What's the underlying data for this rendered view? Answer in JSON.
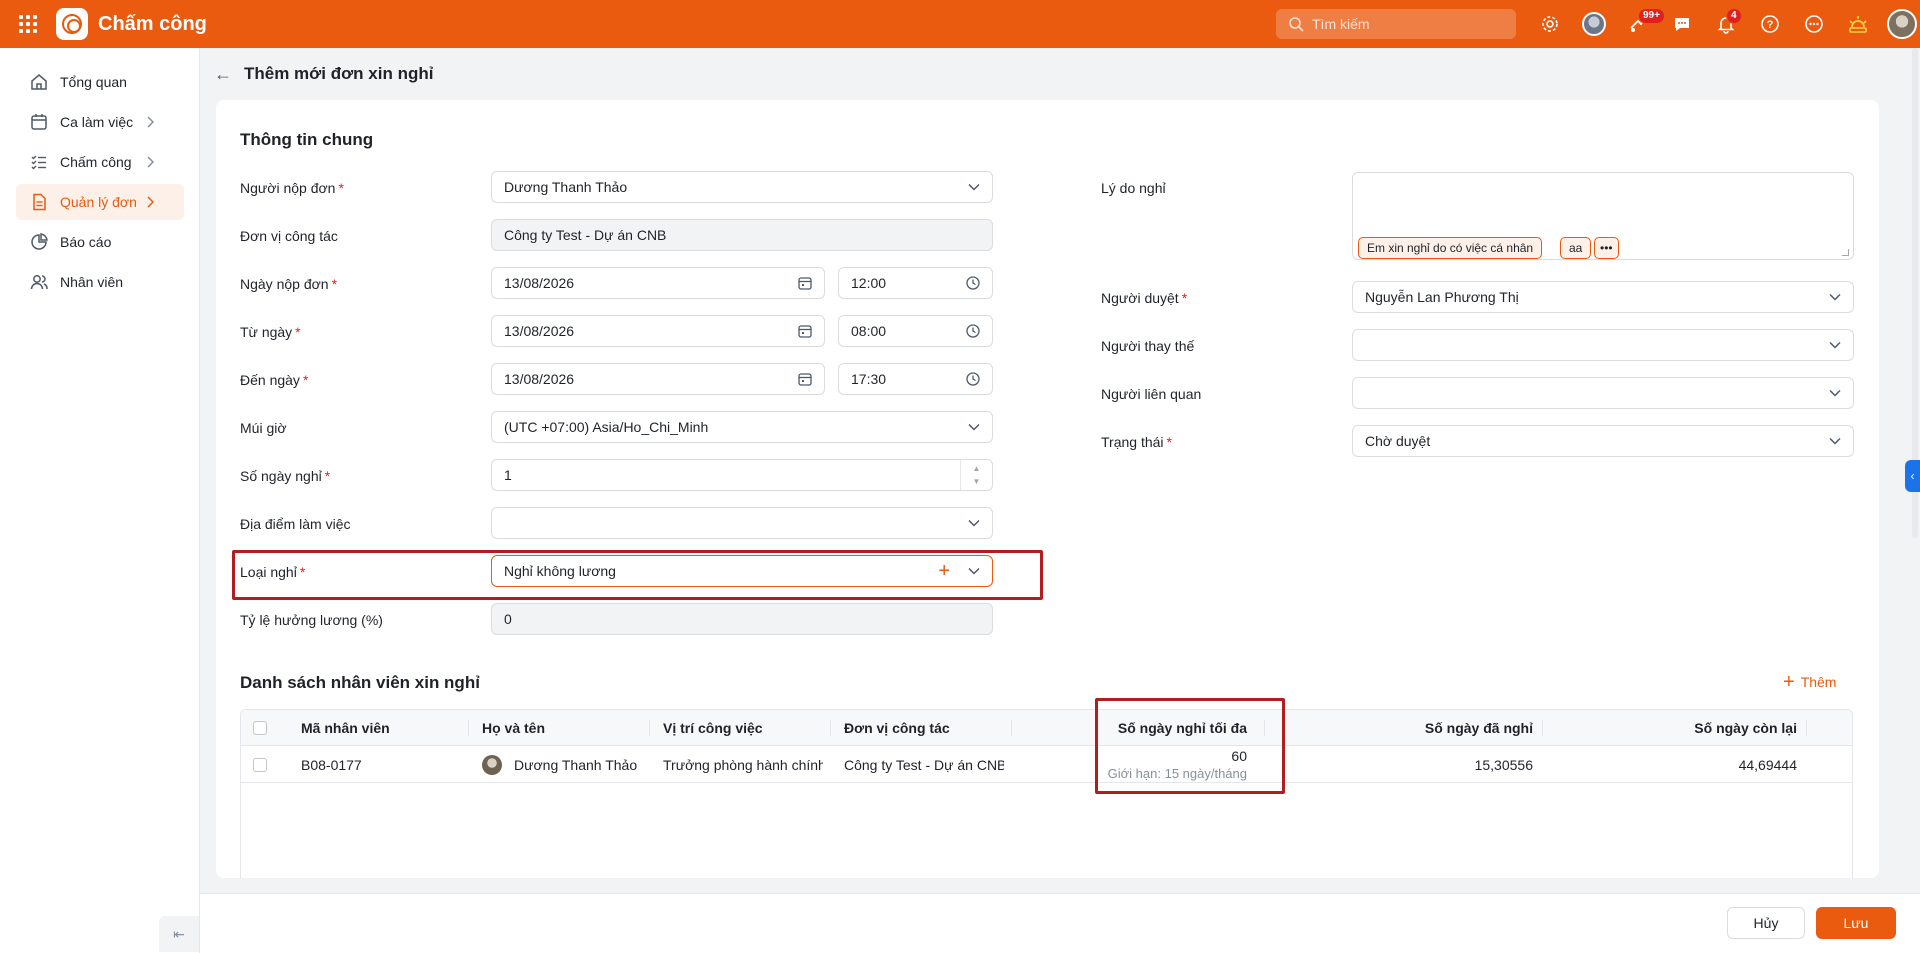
{
  "app": {
    "name": "Chấm công"
  },
  "topbar": {
    "search_placeholder": "Tìm kiếm",
    "badges": {
      "apps": "99+",
      "notifications": "4"
    }
  },
  "sidebar": {
    "items": [
      {
        "label": "Tổng quan"
      },
      {
        "label": "Ca làm việc"
      },
      {
        "label": "Chấm công"
      },
      {
        "label": "Quản lý đơn"
      },
      {
        "label": "Báo cáo"
      },
      {
        "label": "Nhân viên"
      }
    ]
  },
  "page": {
    "title": "Thêm mới đơn xin nghỉ"
  },
  "general": {
    "section_title": "Thông tin chung",
    "submitter": {
      "label": "Người nộp đơn",
      "value": "Dương Thanh Thảo"
    },
    "unit": {
      "label": "Đơn vị công tác",
      "value": "Công ty Test - Dự án CNB"
    },
    "submit_date": {
      "label": "Ngày nộp đơn",
      "date": "13/08/2026",
      "time": "12:00"
    },
    "from_date": {
      "label": "Từ ngày",
      "date": "13/08/2026",
      "time": "08:00"
    },
    "to_date": {
      "label": "Đến ngày",
      "date": "13/08/2026",
      "time": "17:30"
    },
    "timezone": {
      "label": "Múi giờ",
      "value": "(UTC +07:00) Asia/Ho_Chi_Minh"
    },
    "days_off": {
      "label": "Số ngày nghỉ",
      "value": "1"
    },
    "work_location": {
      "label": "Địa điểm làm việc",
      "value": ""
    },
    "leave_type": {
      "label": "Loại nghỉ",
      "value": "Nghỉ không lương"
    },
    "salary_rate": {
      "label": "Tỷ lệ hưởng lương (%)",
      "value": "0"
    },
    "reason": {
      "label": "Lý do nghỉ",
      "chips": [
        "Em xin nghỉ do có việc cá nhân",
        "aa",
        "•••"
      ]
    },
    "approver": {
      "label": "Người duyệt",
      "value": "Nguyễn Lan Phương Thị"
    },
    "substitute": {
      "label": "Người thay thế",
      "value": ""
    },
    "related": {
      "label": "Người liên quan",
      "value": ""
    },
    "status": {
      "label": "Trạng thái",
      "value": "Chờ duyệt"
    }
  },
  "employees": {
    "section_title": "Danh sách nhân viên xin nghỉ",
    "add_label": "Thêm",
    "columns": [
      "Mã nhân viên",
      "Họ và tên",
      "Vị trí công việc",
      "Đơn vị công tác",
      "Số ngày nghỉ tối đa",
      "Số ngày đã nghỉ",
      "Số ngày còn lại"
    ],
    "rows": [
      {
        "code": "B08-0177",
        "name": "Dương Thanh Thảo",
        "position": "Trưởng phòng hành chính",
        "unit": "Công ty Test - Dự án CNB",
        "max_days": "60",
        "limit_note": "Giới hạn: 15 ngày/tháng",
        "used_days": "15,30556",
        "remaining_days": "44,69444"
      }
    ]
  },
  "footer": {
    "cancel_label": "Hủy",
    "save_label": "Lưu"
  },
  "colors": {
    "brand": "#ea5a0f",
    "annotation": "#b21d1d"
  }
}
